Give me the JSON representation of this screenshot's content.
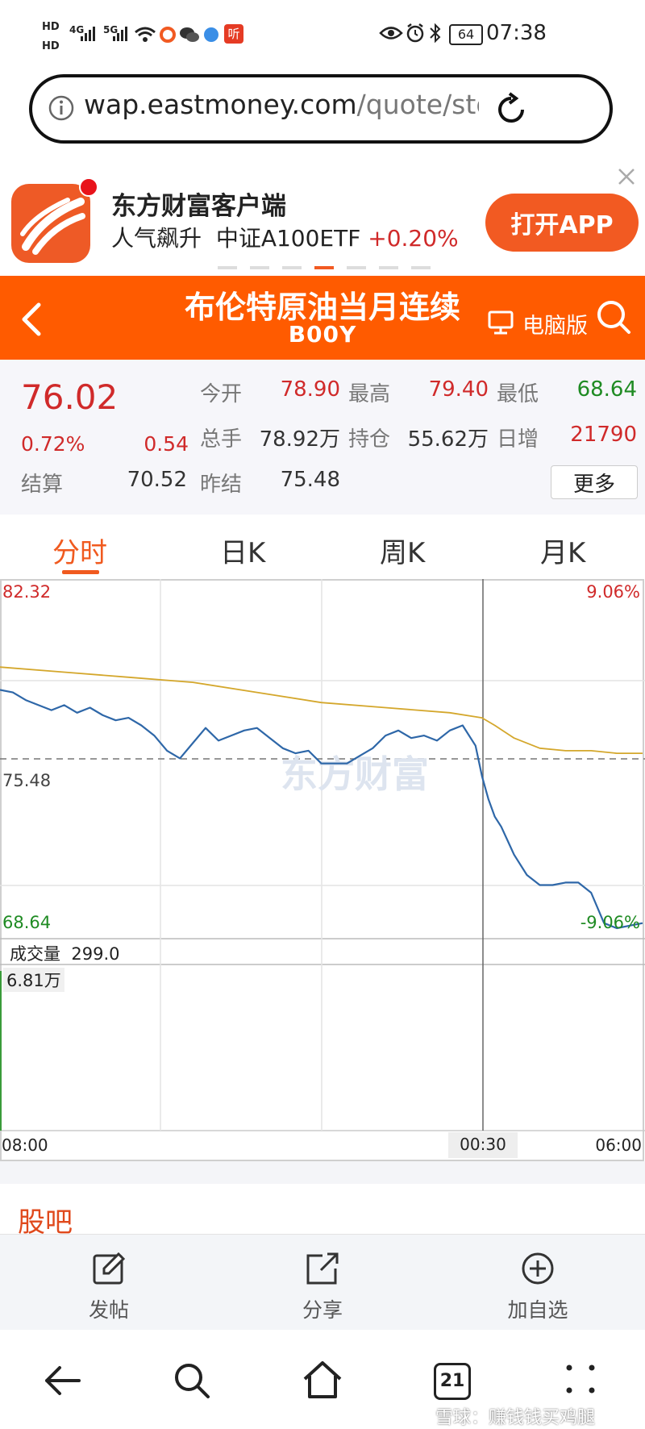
{
  "status_bar": {
    "left_labels": [
      "HD",
      "HD",
      "4G",
      "5G"
    ],
    "listen_badge": "听",
    "battery": "64",
    "time": "07:38"
  },
  "url_bar": {
    "host": "wap.eastmoney.com",
    "path": "/quote/stock/"
  },
  "promo": {
    "app_name": "东方财富客户端",
    "tagline_prefix": "人气飙升",
    "tagline_fund": "中证A100ETF",
    "tagline_change": "+0.20%",
    "open_button": "打开APP"
  },
  "header": {
    "title": "布伦特原油当月连续",
    "code": "B00Y",
    "desktop_label": "电脑版"
  },
  "quote": {
    "price": "76.02",
    "change_pct": "0.72%",
    "change_abs": "0.54",
    "rows": [
      [
        {
          "label": "今开",
          "value": "78.90",
          "color": "red"
        },
        {
          "label": "最高",
          "value": "79.40",
          "color": "red"
        },
        {
          "label": "最低",
          "value": "68.64",
          "color": "green"
        }
      ],
      [
        {
          "label": "总手",
          "value": "78.92万",
          "color": "dark"
        },
        {
          "label": "持仓",
          "value": "55.62万",
          "color": "dark"
        },
        {
          "label": "日增",
          "value": "21790",
          "color": "red"
        }
      ]
    ],
    "settle_label": "结算",
    "settle_value": "70.52",
    "prev_settle_label": "昨结",
    "prev_settle_value": "75.48",
    "more_button": "更多"
  },
  "tabs": [
    "分时",
    "日K",
    "周K",
    "月K"
  ],
  "chart_data": {
    "type": "line",
    "y_max_label": "82.32",
    "y_ref_label": "75.48",
    "y_min_label": "68.64",
    "pct_max_label": "9.06%",
    "pct_min_label": "-9.06%",
    "ylim": [
      68.64,
      82.32
    ],
    "reference": 75.48,
    "volume_title": "成交量",
    "volume_value": "299.0",
    "volume_max_label": "6.81万",
    "x_labels": [
      "08:00",
      "00:30",
      "06:00"
    ],
    "series": [
      {
        "color": "#2e67a8",
        "x": [
          0,
          2,
          4,
          6,
          8,
          10,
          12,
          14,
          16,
          18,
          20,
          22,
          24,
          26,
          28,
          30,
          32,
          34,
          36,
          38,
          40,
          42,
          44,
          46,
          48,
          50,
          52,
          54,
          56,
          58,
          60,
          62,
          64,
          66,
          68,
          70,
          72,
          74,
          75,
          76,
          77,
          78,
          80,
          82,
          84,
          86,
          88,
          90,
          92,
          94,
          96,
          98,
          100
        ],
        "values": [
          78.2,
          78.1,
          77.8,
          77.6,
          77.4,
          77.6,
          77.3,
          77.5,
          77.2,
          77.0,
          77.1,
          76.8,
          76.4,
          75.8,
          75.5,
          76.1,
          76.7,
          76.2,
          76.4,
          76.6,
          76.7,
          76.3,
          75.9,
          75.7,
          75.8,
          75.3,
          75.3,
          75.3,
          75.6,
          75.9,
          76.4,
          76.6,
          76.3,
          76.4,
          76.2,
          76.6,
          76.8,
          76.0,
          74.8,
          73.9,
          73.2,
          72.8,
          71.7,
          70.9,
          70.5,
          70.5,
          70.6,
          70.6,
          70.2,
          69.0,
          68.8,
          68.9,
          69.0
        ]
      },
      {
        "color": "#d4a72c",
        "x": [
          0,
          10,
          20,
          30,
          40,
          50,
          60,
          70,
          75,
          77,
          80,
          84,
          88,
          92,
          96,
          100
        ],
        "values": [
          79.1,
          78.9,
          78.7,
          78.5,
          78.1,
          77.7,
          77.5,
          77.3,
          77.1,
          76.8,
          76.3,
          75.9,
          75.8,
          75.8,
          75.7,
          75.7
        ]
      }
    ]
  },
  "toolbar": [
    {
      "label": "发帖",
      "icon": "edit-icon"
    },
    {
      "label": "分享",
      "icon": "share-icon"
    },
    {
      "label": "加自选",
      "icon": "add-icon"
    }
  ],
  "section_title": "股吧",
  "nav": {
    "tab_count": "21"
  },
  "watermark": "雪球：赚钱钱买鸡腿"
}
